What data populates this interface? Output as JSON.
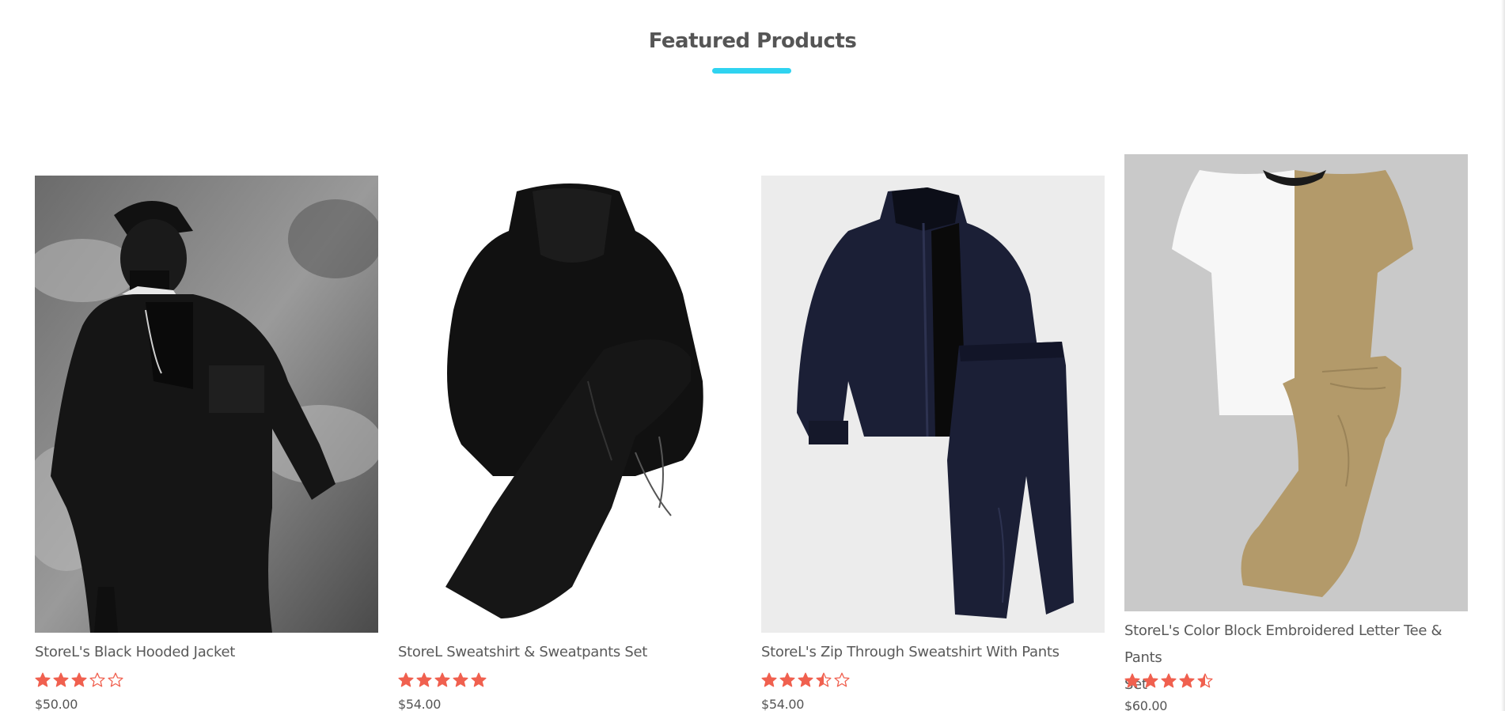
{
  "section": {
    "title": "Featured Products"
  },
  "colors": {
    "accent_underline": "#2fd3f0",
    "star": "#f0604f",
    "text": "#595959"
  },
  "products": [
    {
      "name": "StoreL's Black Hooded Jacket",
      "rating": 3,
      "price": "$50.00",
      "image_icon": "black-hooded-jacket-photo"
    },
    {
      "name": "StoreL Sweatshirt & Sweatpants Set",
      "rating": 5,
      "price": "$54.00",
      "image_icon": "black-hoodie-sweatpants-photo"
    },
    {
      "name": "StoreL's Zip Through Sweatshirt With Pants",
      "rating": 3.5,
      "price": "$54.00",
      "image_icon": "navy-tracksuit-photo"
    },
    {
      "name": "StoreL's Color Block Embroidered Letter Tee & Pants",
      "name_line2": "Set",
      "rating": 4.5,
      "price": "$60.00",
      "image_icon": "color-block-tee-pants-photo"
    }
  ]
}
